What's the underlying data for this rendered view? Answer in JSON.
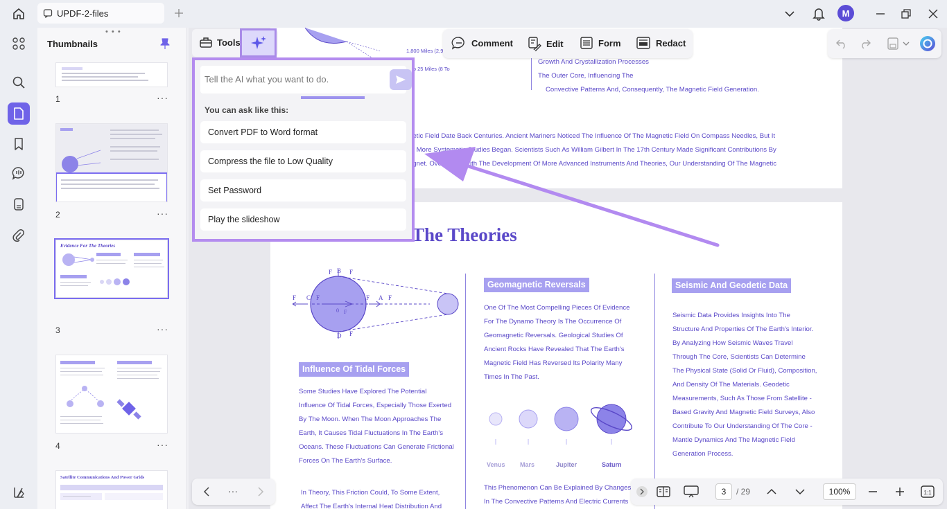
{
  "titlebar": {
    "tab_title": "UPDF-2-files",
    "avatar_initial": "M"
  },
  "thumbnails": {
    "header": "Thumbnails",
    "pages": [
      {
        "num": "1"
      },
      {
        "num": "2"
      },
      {
        "num": "3",
        "title": "Evidence For The Theories"
      },
      {
        "num": "4"
      },
      {
        "title": "Satellite Communications And Power Grids"
      }
    ],
    "more": "···"
  },
  "toolbar": {
    "tools_label": "Tools",
    "modes": [
      "Comment",
      "Edit",
      "Form",
      "Redact"
    ]
  },
  "ai_popup": {
    "placeholder": "Tell the AI what you want to do.",
    "hint": "You can ask like this:",
    "suggestions": [
      "Convert PDF to Word format",
      "Compress the file to Low Quality",
      "Set Password",
      "Play the slideshow"
    ]
  },
  "page_top": {
    "diagram_labels": [
      "1,800 Miles (2,900...",
      "5 To 25 Miles (8 To"
    ],
    "right_lines": [
      "Growth And Crystallization Processes",
      "The Outer Core, Influencing The",
      "Convective Patterns And, Consequently, The Magnetic Field Generation."
    ],
    "body_lines": [
      "netic Field Date Back Centuries. Ancient Mariners Noticed The Influence Of The Magnetic Field On Compass Needles, But It",
      "at More Systematic Studies Began. Scientists Such As William Gilbert In The 17th Century Made Significant Contributions By",
      "agnet. Over Time, With The Development Of More Advanced Instruments And Theories, Our Understanding Of The Magnetic"
    ]
  },
  "page_main": {
    "heading_partial": "Evidence For ",
    "heading_visible": "The Theories",
    "diagram_labels": [
      "F",
      "B",
      "F",
      "C",
      "F",
      "F",
      "F",
      "A",
      "F",
      "0",
      "F",
      "D",
      "F"
    ],
    "tidal": {
      "title": "Influence Of Tidal Forces",
      "lines": [
        "Some Studies Have Explored The Potential",
        "Influence Of Tidal Forces, Especially Those Exerted",
        "By The Moon. When The Moon Approaches The",
        "Earth, It Causes Tidal Fluctuations In The Earth's",
        "Oceans. These Fluctuations Can Generate Frictional",
        "Forces On The Earth's Surface."
      ],
      "lines2": [
        "In Theory, This Friction Could, To Some Extent,",
        "Affect The Earth's Internal Heat Distribution And"
      ]
    },
    "geomagnetic": {
      "title": "Geomagnetic Reversals",
      "lines": [
        "One Of The Most Compelling Pieces Of Evidence",
        "For The Dynamo Theory Is The Occurrence Of",
        "Geomagnetic Reversals. Geological Studies Of",
        "Ancient Rocks Have Revealed That The Earth's",
        "Magnetic Field Has Reversed Its Polarity Many",
        "Times In The Past."
      ],
      "planets": [
        "Venus",
        "Mars",
        "Jupiter",
        "Saturn"
      ],
      "lines2": [
        "This Phenomenon Can Be Explained By Changes",
        "In The Convective Patterns And Electric Currents"
      ]
    },
    "seismic": {
      "title": "Seismic And Geodetic Data",
      "lines": [
        "Seismic Data Provides Insights Into The",
        "Structure And Properties Of The Earth's Interior.",
        "By Analyzing How Seismic Waves Travel",
        "Through The Core, Scientists Can Determine",
        "The Physical State (Solid Or Fluid), Composition,",
        "And Density Of The Materials. Geodetic",
        "Measurements, Such As Those From Satellite -",
        "Based Gravity And Magnetic Field Surveys, Also",
        "Contribute To Our Understanding Of The Core -",
        "Mantle Dynamics And The Magnetic Field",
        "Generation Process."
      ]
    }
  },
  "bottom": {
    "more": "···",
    "current_page": "3",
    "total_pages": "/ 29",
    "zoom": "100%"
  },
  "colors": {
    "accent": "#6f63e8",
    "highlight": "#b48cef",
    "doc_text": "#5a48c8"
  }
}
